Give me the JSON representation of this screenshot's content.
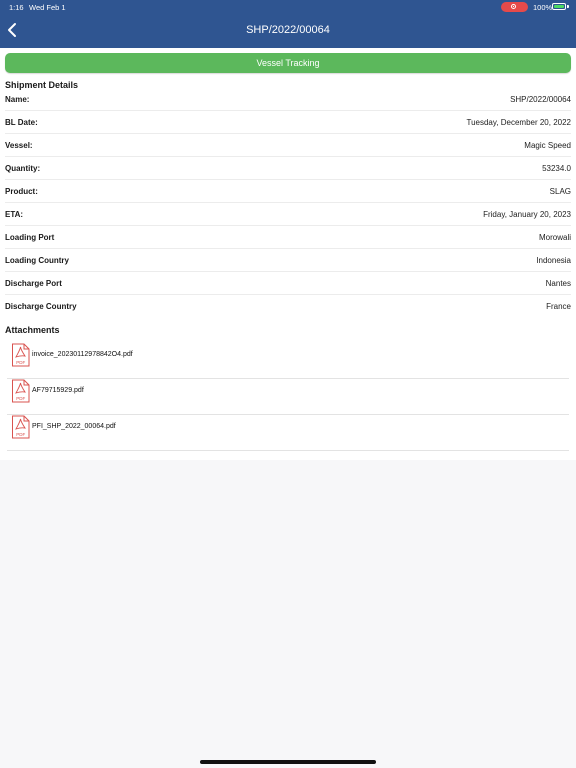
{
  "status_bar": {
    "time": "1:16",
    "date": "Wed Feb 1",
    "battery": "100%"
  },
  "header": {
    "title": "SHP/2022/00064",
    "bar_color": "#2f5591"
  },
  "vessel_tracking": {
    "label": "Vessel Tracking",
    "color": "#5cb85c"
  },
  "shipment": {
    "title": "Shipment Details",
    "rows": [
      {
        "label": "Name:",
        "value": "SHP/2022/00064"
      },
      {
        "label": "BL Date:",
        "value": "Tuesday, December 20, 2022"
      },
      {
        "label": "Vessel:",
        "value": "Magic Speed"
      },
      {
        "label": "Quantity:",
        "value": "53234.0"
      },
      {
        "label": "Product:",
        "value": "SLAG"
      },
      {
        "label": "ETA:",
        "value": "Friday, January 20, 2023"
      },
      {
        "label": "Loading Port",
        "value": "Morowali"
      },
      {
        "label": "Loading Country",
        "value": "Indonesia"
      },
      {
        "label": "Discharge Port",
        "value": "Nantes"
      },
      {
        "label": "Discharge Country",
        "value": "France"
      }
    ]
  },
  "attachments": {
    "title": "Attachments",
    "icon": "pdf-file-icon",
    "icon_label": "PDF",
    "items": [
      {
        "name": "invoice_20230112978842O4.pdf"
      },
      {
        "name": "AF79715929.pdf"
      },
      {
        "name": "PFI_SHP_2022_00064.pdf"
      }
    ]
  }
}
